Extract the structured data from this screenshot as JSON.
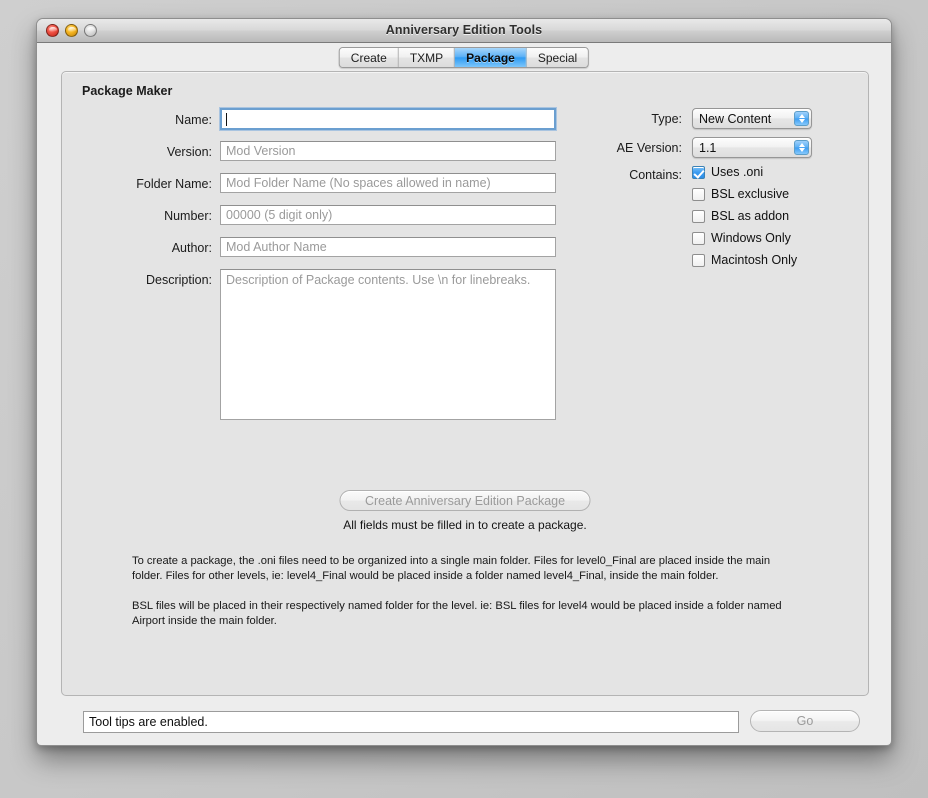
{
  "window": {
    "title": "Anniversary Edition Tools",
    "traffic_lights": [
      "close-button",
      "minimize-button",
      "zoom-button"
    ]
  },
  "tabs": [
    {
      "label": "Create",
      "active": false
    },
    {
      "label": "TXMP",
      "active": false
    },
    {
      "label": "Package",
      "active": true
    },
    {
      "label": "Special",
      "active": false
    }
  ],
  "panel": {
    "heading": "Package Maker",
    "fields": [
      {
        "label": "Name:",
        "placeholder": "",
        "value": "",
        "focused": true
      },
      {
        "label": "Version:",
        "placeholder": "Mod Version",
        "value": "",
        "focused": false
      },
      {
        "label": "Folder Name:",
        "placeholder": "Mod Folder Name (No spaces allowed in name)",
        "value": "",
        "focused": false
      },
      {
        "label": "Number:",
        "placeholder": "00000 (5 digit only)",
        "value": "",
        "focused": false
      },
      {
        "label": "Author:",
        "placeholder": "Mod Author Name",
        "value": "",
        "focused": false
      }
    ],
    "description": {
      "label": "Description:",
      "placeholder": "Description of Package contents. Use \\n for linebreaks.",
      "value": ""
    },
    "type": {
      "label": "Type:",
      "value": "New Content"
    },
    "ae_version": {
      "label": "AE Version:",
      "value": "1.1"
    },
    "contains": {
      "label": "Contains:",
      "options": [
        {
          "label": "Uses .oni",
          "checked": true
        },
        {
          "label": "BSL exclusive",
          "checked": false
        },
        {
          "label": "BSL as addon",
          "checked": false
        },
        {
          "label": "Windows Only",
          "checked": false
        },
        {
          "label": "Macintosh Only",
          "checked": false
        }
      ]
    },
    "create_button": {
      "label": "Create Anniversary Edition Package",
      "enabled": false
    },
    "hint": "All fields must be filled in to create a package.",
    "paragraphs": [
      "To create a package, the .oni files need to be organized into a single main folder.  Files for level0_Final are placed inside the main folder.  Files for other levels, ie: level4_Final would be placed inside a folder named level4_Final, inside the main folder.",
      "BSL files will be placed in their respectively named folder for the level.  ie: BSL files for level4 would be placed inside a folder named Airport inside the main folder."
    ]
  },
  "status_bar": {
    "message": "Tool tips are enabled.",
    "go_button": "Go"
  },
  "colors": {
    "accent": "#2f9bf3",
    "window_bg": "#ededed",
    "panel_bg": "#e4e4e4",
    "focus_ring": "#6b9fd0"
  }
}
